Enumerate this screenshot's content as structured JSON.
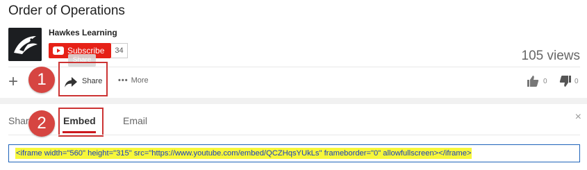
{
  "video": {
    "title": "Order of Operations",
    "views": "105 views"
  },
  "channel": {
    "name": "Hawkes Learning",
    "subscribe_label": "Subscribe",
    "subscriber_count": "34"
  },
  "actions": {
    "add_symbol": "+",
    "share_label": "Share",
    "share_tooltip": "Share",
    "more_dots": "•••",
    "more_label": "More",
    "like_count": "0",
    "dislike_count": "0"
  },
  "share_panel": {
    "tabs": [
      {
        "label": "Share"
      },
      {
        "label": "Embed"
      },
      {
        "label": "Email"
      }
    ],
    "active_tab": "Embed",
    "close_symbol": "×",
    "embed_code": "<iframe width=\"560\" height=\"315\" src=\"https://www.youtube.com/embed/QCZHqsYUkLs\" frameborder=\"0\" allowfullscreen></iframe>"
  },
  "annotations": {
    "step1": "1",
    "step2": "2"
  },
  "colors": {
    "subscribe_red": "#e62117",
    "annotation_red": "#d64541",
    "highlight_yellow": "#f7f73a",
    "embed_border_blue": "#1c62b9"
  },
  "icons": [
    "hawkes-logo-icon",
    "youtube-play-icon",
    "share-arrow-icon",
    "thumbs-up-icon",
    "thumbs-down-icon",
    "close-icon"
  ]
}
